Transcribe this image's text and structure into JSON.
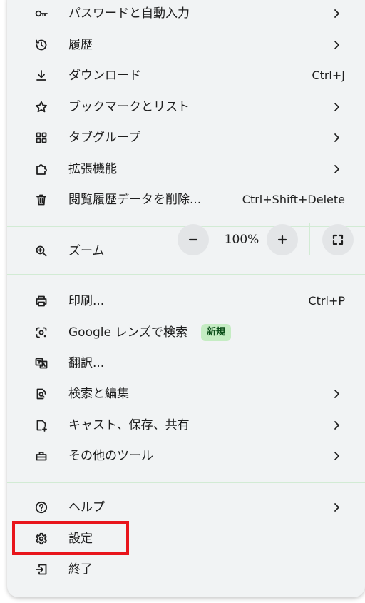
{
  "menu": {
    "items_top": [
      {
        "label": "パスワードと自動入力",
        "icon": "key-icon",
        "chevron": true
      },
      {
        "label": "履歴",
        "icon": "history-icon",
        "chevron": true
      },
      {
        "label": "ダウンロード",
        "icon": "download-icon",
        "shortcut": "Ctrl+J"
      },
      {
        "label": "ブックマークとリスト",
        "icon": "star-icon",
        "chevron": true
      },
      {
        "label": "タブグループ",
        "icon": "tab-groups-icon",
        "chevron": true
      },
      {
        "label": "拡張機能",
        "icon": "extension-icon",
        "chevron": true
      },
      {
        "label": "閲覧履歴データを削除...",
        "icon": "trash-icon",
        "shortcut": "Ctrl+Shift+Delete"
      }
    ],
    "zoom": {
      "label": "ズーム",
      "value": "100%",
      "minus_icon": "minus-icon",
      "plus_icon": "plus-icon",
      "fullscreen_icon": "fullscreen-icon"
    },
    "items_middle": [
      {
        "label": "印刷...",
        "icon": "print-icon",
        "shortcut": "Ctrl+P"
      },
      {
        "label": "Google レンズで検索",
        "icon": "lens-icon",
        "badge": "新規"
      },
      {
        "label": "翻訳...",
        "icon": "translate-icon"
      },
      {
        "label": "検索と編集",
        "icon": "find-edit-icon",
        "chevron": true
      },
      {
        "label": "キャスト、保存、共有",
        "icon": "cast-save-share-icon",
        "chevron": true
      },
      {
        "label": "その他のツール",
        "icon": "toolbox-icon",
        "chevron": true
      }
    ],
    "items_bottom": [
      {
        "label": "ヘルプ",
        "icon": "help-icon",
        "chevron": true
      },
      {
        "label": "設定",
        "icon": "settings-icon",
        "highlighted": true
      },
      {
        "label": "終了",
        "icon": "exit-icon"
      }
    ]
  },
  "colors": {
    "menu_background": "#f1f3f4",
    "separator": "#d2ebd4",
    "badge_background": "#c5ecc3",
    "badge_text": "#0d4e1a",
    "highlight_border": "#e8141b",
    "zoom_button": "#e3e5e7"
  }
}
